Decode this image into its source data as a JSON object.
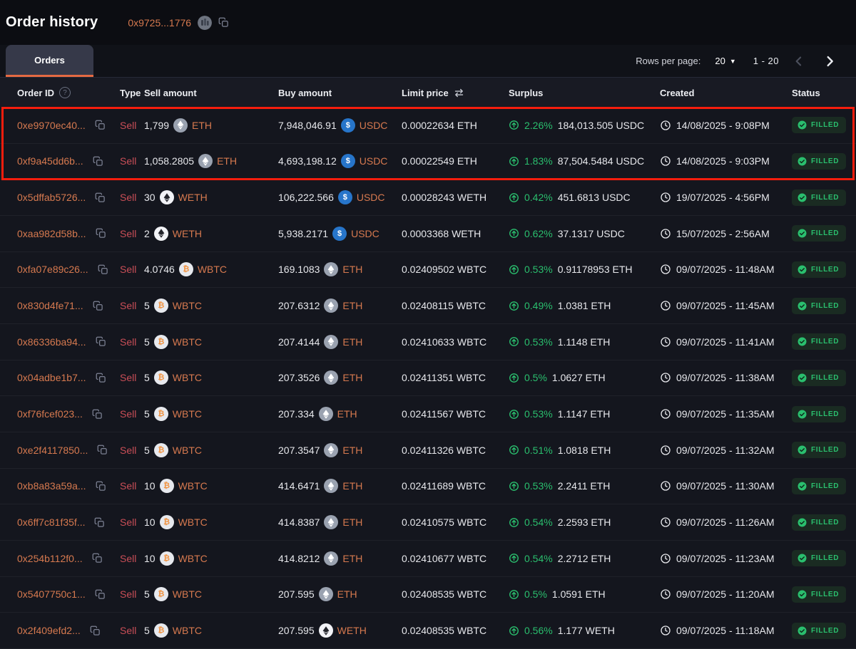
{
  "colors": {
    "bg": "#0c0d12",
    "text": "#e9eaee",
    "accent_orange": "#d6794f",
    "tab_underline": "#e56a42",
    "sell_red": "#c94e57",
    "green": "#2abf6e",
    "highlight_red": "#f51d0d"
  },
  "header": {
    "title": "Order history",
    "address": "0x9725...1776"
  },
  "tabs": {
    "orders": "Orders"
  },
  "pagination": {
    "rows_per_page_label": "Rows per page:",
    "rows_per_page": "20",
    "range": "1 - 20"
  },
  "icons": {
    "help": "?",
    "caret_down": "▼"
  },
  "tokens": {
    "ETH": {
      "bg": "#9aa2b0",
      "fg": "#ffffff",
      "glyph": "eth"
    },
    "WETH": {
      "bg": "#f2f3f7",
      "fg": "#23242b",
      "glyph": "eth"
    },
    "WBTC": {
      "bg": "#e7e9ee",
      "fg": "#f09342",
      "glyph": "btc"
    },
    "USDC": {
      "bg": "#2775ca",
      "fg": "#ffffff",
      "glyph": "usd"
    }
  },
  "table": {
    "headers": {
      "order_id": "Order ID",
      "type": "Type",
      "sell": "Sell amount",
      "buy": "Buy amount",
      "limit": "Limit price",
      "surplus": "Surplus",
      "created": "Created",
      "status": "Status"
    },
    "rows": [
      {
        "id": "0xe9970ec40...",
        "type": "Sell",
        "sell_amount": "1,799",
        "sell_token": "ETH",
        "buy_amount": "7,948,046.91",
        "buy_token": "USDC",
        "limit_price": "0.00022634 ETH",
        "surplus_pct": "2.26%",
        "surplus_amount": "184,013.505 USDC",
        "created": "14/08/2025 - 9:08PM",
        "status": "FILLED",
        "highlighted": true
      },
      {
        "id": "0xf9a45dd6b...",
        "type": "Sell",
        "sell_amount": "1,058.2805",
        "sell_token": "ETH",
        "buy_amount": "4,693,198.12",
        "buy_token": "USDC",
        "limit_price": "0.00022549 ETH",
        "surplus_pct": "1.83%",
        "surplus_amount": "87,504.5484 USDC",
        "created": "14/08/2025 - 9:03PM",
        "status": "FILLED",
        "highlighted": true
      },
      {
        "id": "0x5dffab5726...",
        "type": "Sell",
        "sell_amount": "30",
        "sell_token": "WETH",
        "buy_amount": "106,222.566",
        "buy_token": "USDC",
        "limit_price": "0.00028243 WETH",
        "surplus_pct": "0.42%",
        "surplus_amount": "451.6813 USDC",
        "created": "19/07/2025 - 4:56PM",
        "status": "FILLED",
        "highlighted": false
      },
      {
        "id": "0xaa982d58b...",
        "type": "Sell",
        "sell_amount": "2",
        "sell_token": "WETH",
        "buy_amount": "5,938.2171",
        "buy_token": "USDC",
        "limit_price": "0.0003368 WETH",
        "surplus_pct": "0.62%",
        "surplus_amount": "37.1317 USDC",
        "created": "15/07/2025 - 2:56AM",
        "status": "FILLED",
        "highlighted": false
      },
      {
        "id": "0xfa07e89c26...",
        "type": "Sell",
        "sell_amount": "4.0746",
        "sell_token": "WBTC",
        "buy_amount": "169.1083",
        "buy_token": "ETH",
        "limit_price": "0.02409502 WBTC",
        "surplus_pct": "0.53%",
        "surplus_amount": "0.91178953 ETH",
        "created": "09/07/2025 - 11:48AM",
        "status": "FILLED",
        "highlighted": false
      },
      {
        "id": "0x830d4fe71...",
        "type": "Sell",
        "sell_amount": "5",
        "sell_token": "WBTC",
        "buy_amount": "207.6312",
        "buy_token": "ETH",
        "limit_price": "0.02408115 WBTC",
        "surplus_pct": "0.49%",
        "surplus_amount": "1.0381 ETH",
        "created": "09/07/2025 - 11:45AM",
        "status": "FILLED",
        "highlighted": false
      },
      {
        "id": "0x86336ba94...",
        "type": "Sell",
        "sell_amount": "5",
        "sell_token": "WBTC",
        "buy_amount": "207.4144",
        "buy_token": "ETH",
        "limit_price": "0.02410633 WBTC",
        "surplus_pct": "0.53%",
        "surplus_amount": "1.1148 ETH",
        "created": "09/07/2025 - 11:41AM",
        "status": "FILLED",
        "highlighted": false
      },
      {
        "id": "0x04adbe1b7...",
        "type": "Sell",
        "sell_amount": "5",
        "sell_token": "WBTC",
        "buy_amount": "207.3526",
        "buy_token": "ETH",
        "limit_price": "0.02411351 WBTC",
        "surplus_pct": "0.5%",
        "surplus_amount": "1.0627 ETH",
        "created": "09/07/2025 - 11:38AM",
        "status": "FILLED",
        "highlighted": false
      },
      {
        "id": "0xf76fcef023...",
        "type": "Sell",
        "sell_amount": "5",
        "sell_token": "WBTC",
        "buy_amount": "207.334",
        "buy_token": "ETH",
        "limit_price": "0.02411567 WBTC",
        "surplus_pct": "0.53%",
        "surplus_amount": "1.1147 ETH",
        "created": "09/07/2025 - 11:35AM",
        "status": "FILLED",
        "highlighted": false
      },
      {
        "id": "0xe2f4117850...",
        "type": "Sell",
        "sell_amount": "5",
        "sell_token": "WBTC",
        "buy_amount": "207.3547",
        "buy_token": "ETH",
        "limit_price": "0.02411326 WBTC",
        "surplus_pct": "0.51%",
        "surplus_amount": "1.0818 ETH",
        "created": "09/07/2025 - 11:32AM",
        "status": "FILLED",
        "highlighted": false
      },
      {
        "id": "0xb8a83a59a...",
        "type": "Sell",
        "sell_amount": "10",
        "sell_token": "WBTC",
        "buy_amount": "414.6471",
        "buy_token": "ETH",
        "limit_price": "0.02411689 WBTC",
        "surplus_pct": "0.53%",
        "surplus_amount": "2.2411 ETH",
        "created": "09/07/2025 - 11:30AM",
        "status": "FILLED",
        "highlighted": false
      },
      {
        "id": "0x6ff7c81f35f...",
        "type": "Sell",
        "sell_amount": "10",
        "sell_token": "WBTC",
        "buy_amount": "414.8387",
        "buy_token": "ETH",
        "limit_price": "0.02410575 WBTC",
        "surplus_pct": "0.54%",
        "surplus_amount": "2.2593 ETH",
        "created": "09/07/2025 - 11:26AM",
        "status": "FILLED",
        "highlighted": false
      },
      {
        "id": "0x254b112f0...",
        "type": "Sell",
        "sell_amount": "10",
        "sell_token": "WBTC",
        "buy_amount": "414.8212",
        "buy_token": "ETH",
        "limit_price": "0.02410677 WBTC",
        "surplus_pct": "0.54%",
        "surplus_amount": "2.2712 ETH",
        "created": "09/07/2025 - 11:23AM",
        "status": "FILLED",
        "highlighted": false
      },
      {
        "id": "0x5407750c1...",
        "type": "Sell",
        "sell_amount": "5",
        "sell_token": "WBTC",
        "buy_amount": "207.595",
        "buy_token": "ETH",
        "limit_price": "0.02408535 WBTC",
        "surplus_pct": "0.5%",
        "surplus_amount": "1.0591 ETH",
        "created": "09/07/2025 - 11:20AM",
        "status": "FILLED",
        "highlighted": false
      },
      {
        "id": "0x2f409efd2...",
        "type": "Sell",
        "sell_amount": "5",
        "sell_token": "WBTC",
        "buy_amount": "207.595",
        "buy_token": "WETH",
        "limit_price": "0.02408535 WBTC",
        "surplus_pct": "0.56%",
        "surplus_amount": "1.177 WETH",
        "created": "09/07/2025 - 11:18AM",
        "status": "FILLED",
        "highlighted": false
      }
    ]
  }
}
